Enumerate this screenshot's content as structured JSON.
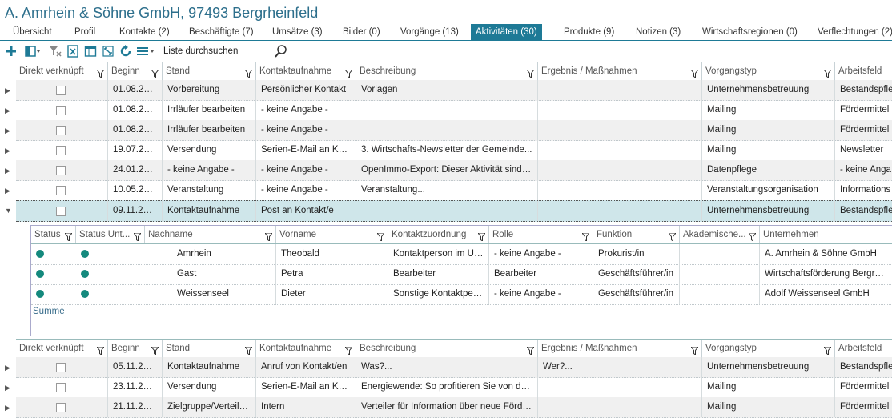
{
  "company_title": "A. Amrhein & Söhne GmbH, 97493 Bergrheinfeld",
  "tabs": [
    "Übersicht",
    "Profil",
    "Kontakte (2)",
    "Beschäftigte (7)",
    "Umsätze (3)",
    "Bilder (0)",
    "Vorgänge (13)",
    "Aktivitäten (30)",
    "Produkte (9)",
    "Notizen (3)",
    "Wirtschaftsregionen (0)",
    "Verflechtungen (2)"
  ],
  "active_tab": "Aktivitäten (30)",
  "search": {
    "placeholder": "Liste durchsuchen"
  },
  "columns": [
    "Direkt verknüpft",
    "Beginn",
    "Stand",
    "Kontaktaufnahme",
    "Beschreibung",
    "Ergebnis / Maßnahmen",
    "Vorgangstyp",
    "Arbeitsfeld"
  ],
  "rows": [
    {
      "beginn": "01.08.2018",
      "stand": "Vorbereitung",
      "kontakt": "Persönlicher Kontakt",
      "beschreibung": "Vorlagen",
      "ergebnis": "",
      "typ": "Unternehmensbetreuung",
      "feld": "Bestandspfle"
    },
    {
      "beginn": "01.08.2018",
      "stand": "Irrläufer bearbeiten",
      "kontakt": "- keine Angabe -",
      "beschreibung": "",
      "ergebnis": "",
      "typ": "Mailing",
      "feld": "Fördermittel"
    },
    {
      "beginn": "01.08.2018",
      "stand": "Irrläufer bearbeiten",
      "kontakt": "- keine Angabe -",
      "beschreibung": "",
      "ergebnis": "",
      "typ": "Mailing",
      "feld": "Fördermittel"
    },
    {
      "beginn": "19.07.2018",
      "stand": "Versendung",
      "kontakt": "Serien-E-Mail an Ko...",
      "beschreibung": "3. Wirtschafts-Newsletter der Gemeinde...",
      "ergebnis": "",
      "typ": "Mailing",
      "feld": "Newsletter"
    },
    {
      "beginn": "24.01.2017",
      "stand": "- keine Angabe -",
      "kontakt": "- keine Angabe -",
      "beschreibung": "OpenImmo-Export: Dieser Aktivität sind al...",
      "ergebnis": "",
      "typ": "Datenpflege",
      "feld": "- keine Anga"
    },
    {
      "beginn": "10.05.2016",
      "stand": "Veranstaltung",
      "kontakt": "- keine Angabe -",
      "beschreibung": "Veranstaltung...",
      "ergebnis": "",
      "typ": "Veranstaltungsorganisation",
      "feld": "Informations"
    },
    {
      "beginn": "09.11.2012",
      "stand": "Kontaktaufnahme",
      "kontakt": "Post an Kontakt/e",
      "beschreibung": "",
      "ergebnis": "",
      "typ": "Unternehmensbetreuung",
      "feld": "Bestandspfle"
    }
  ],
  "sub_columns": [
    "Status",
    "Status Unt...",
    "Nachname",
    "Vorname",
    "Kontaktzuordnung",
    "Rolle",
    "Funktion",
    "Akademische...",
    "Unternehmen"
  ],
  "sub_rows": [
    {
      "nachname": "Amrhein",
      "vorname": "Theobald",
      "zuordnung": "Kontaktperson im Unt...",
      "rolle": "- keine Angabe -",
      "funktion": "Prokurist/in",
      "akad": "",
      "unternehmen": "A. Amrhein & Söhne GmbH"
    },
    {
      "nachname": "Gast",
      "vorname": "Petra",
      "zuordnung": "Bearbeiter",
      "rolle": "Bearbeiter",
      "funktion": "Geschäftsführer/in",
      "akad": "",
      "unternehmen": "Wirtschaftsförderung Bergrheinf"
    },
    {
      "nachname": "Weissenseel",
      "vorname": "Dieter",
      "zuordnung": "Sonstige Kontaktpers...",
      "rolle": "- keine Angabe -",
      "funktion": "Geschäftsführer/in",
      "akad": "",
      "unternehmen": "Adolf Weissenseel GmbH"
    }
  ],
  "summe_label": "Summe",
  "rows2": [
    {
      "beginn": "05.11.2012",
      "stand": "Kontaktaufnahme",
      "kontakt": "Anruf von Kontakt/en",
      "beschreibung": "Was?...",
      "ergebnis": "Wer?...",
      "typ": "Unternehmensbetreuung",
      "feld": "Bestandspfle"
    },
    {
      "beginn": "23.11.2011",
      "stand": "Versendung",
      "kontakt": "Serien-E-Mail an Ko...",
      "beschreibung": "Energiewende: So profitieren Sie von den...",
      "ergebnis": "",
      "typ": "Mailing",
      "feld": "Fördermittel"
    },
    {
      "beginn": "21.11.2011",
      "stand": "Zielgruppe/Verteile...",
      "kontakt": "Intern",
      "beschreibung": "Verteiler für Information über neue Förder...",
      "ergebnis": "",
      "typ": "Mailing",
      "feld": "Fördermittel"
    }
  ],
  "icons": [
    "add-icon",
    "layout-icon",
    "filter-clear-icon",
    "excel-export-icon",
    "table-icon",
    "expand-icon",
    "refresh-icon",
    "menu-icon"
  ],
  "colors": {
    "accent": "#1e7a96",
    "status_dot": "#14897d",
    "selected_row": "#cfe6ea"
  }
}
